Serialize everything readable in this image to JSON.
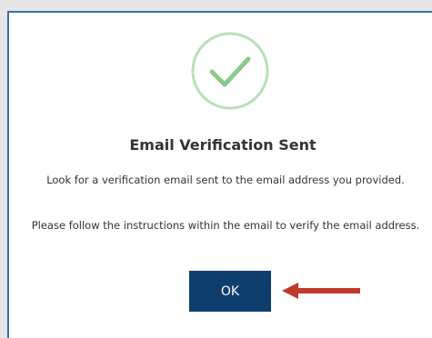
{
  "dialog": {
    "title": "Email Verification Sent",
    "message_1": "Look for a verification email sent to the email address you provided.",
    "message_2": "Please follow the instructions within the email to verify the email address.",
    "ok_label": "OK"
  },
  "icons": {
    "success": "checkmark-circle-icon",
    "annotation": "red-arrow-left-icon"
  },
  "colors": {
    "success_green": "#8cc98a",
    "button_bg": "#0e3e6e",
    "arrow_red": "#c0392b",
    "frame_border": "#3a6ea5"
  }
}
